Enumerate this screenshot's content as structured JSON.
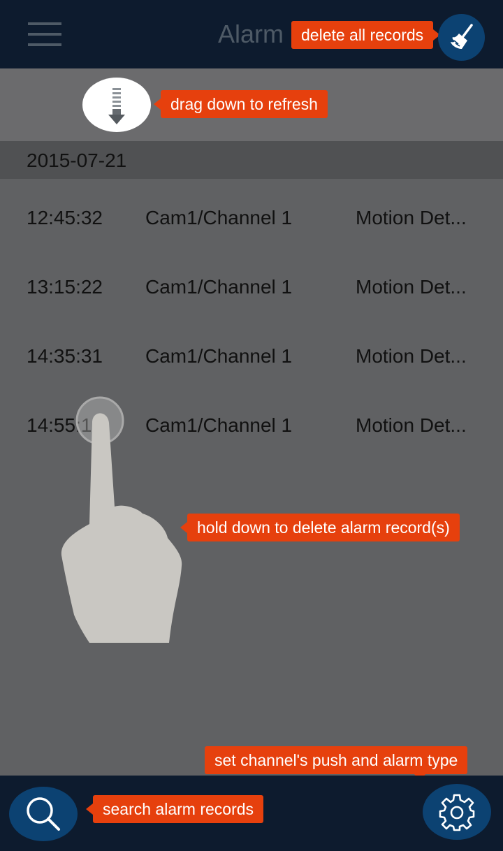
{
  "header": {
    "title": "Alarm",
    "menu_icon": "hamburger-menu-icon",
    "delete_all_icon": "broom-icon"
  },
  "tooltips": {
    "delete_all": "delete all records",
    "refresh": "drag down to refresh",
    "hold_delete": "hold down to delete alarm record(s)",
    "settings": "set channel's push and  alarm type",
    "search": "search alarm records"
  },
  "date_group": "2015-07-21",
  "records": [
    {
      "time": "12:45:32",
      "channel": "Cam1/Channel 1",
      "type": "Motion Det..."
    },
    {
      "time": "13:15:22",
      "channel": "Cam1/Channel 1",
      "type": "Motion Det..."
    },
    {
      "time": "14:35:31",
      "channel": "Cam1/Channel 1",
      "type": "Motion Det..."
    },
    {
      "time": "14:55:1",
      "channel": "Cam1/Channel 1",
      "type": "Motion Det..."
    }
  ],
  "footer": {
    "search_icon": "search-icon",
    "settings_icon": "gear-icon"
  },
  "colors": {
    "header_bg": "#0d1b2e",
    "accent_orange": "#e6400d",
    "button_blue": "#0c4272",
    "content_bg": "#606163"
  }
}
